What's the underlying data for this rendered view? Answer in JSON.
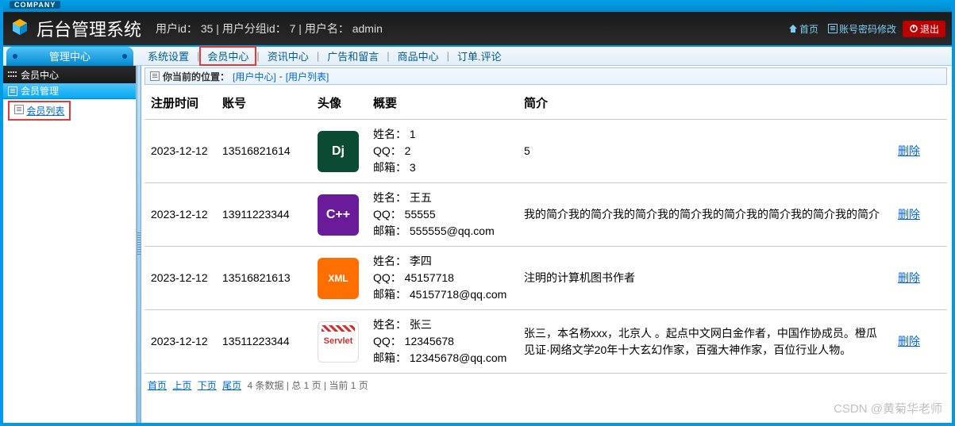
{
  "topbar": {
    "company": "COMPANY"
  },
  "header": {
    "title": "后台管理系统",
    "user_id_label": "用户id：",
    "user_id": "35",
    "group_id_label": "用户分组id：",
    "group_id": "7",
    "username_label": "用户名：",
    "username": "admin",
    "home": "首页",
    "pwd": "账号密码修改",
    "exit": "退出"
  },
  "menu": {
    "admin_tab": "管理中心",
    "items": [
      "系统设置",
      "会员中心",
      "资讯中心",
      "广告和留言",
      "商品中心",
      "订单.评论"
    ]
  },
  "sidebar": {
    "header": "会员中心",
    "section": "会员管理",
    "item": "会员列表"
  },
  "crumb": {
    "prefix": "你当前的位置：",
    "p1": "[用户中心]",
    "sep": "-",
    "p2": "[用户列表]"
  },
  "table": {
    "cols": [
      "注册时间",
      "账号",
      "头像",
      "概要",
      "简介",
      ""
    ],
    "labels": {
      "name": "姓名：",
      "qq": "QQ：",
      "email": "邮箱：",
      "del": "删除"
    },
    "rows": [
      {
        "time": "2023-12-12",
        "acct": "13516821614",
        "avatar": "Dj",
        "avcls": "av-dj",
        "name": "1",
        "qq": "2",
        "email": "3",
        "intro": "5"
      },
      {
        "time": "2023-12-12",
        "acct": "13911223344",
        "avatar": "C++",
        "avcls": "av-cpp",
        "name": "王五",
        "qq": "55555",
        "email": "555555@qq.com",
        "intro": "我的简介我的简介我的简介我的简介我的简介我的简介我的简介我的简介"
      },
      {
        "time": "2023-12-12",
        "acct": "13516821613",
        "avatar": "XML",
        "avcls": "av-xml",
        "name": "李四",
        "qq": "45157718",
        "email": "45157718@qq.com",
        "intro": "注明的计算机图书作者"
      },
      {
        "time": "2023-12-12",
        "acct": "13511223344",
        "avatar": "Servlet",
        "avcls": "av-srv",
        "name": "张三",
        "qq": "12345678",
        "email": "12345678@qq.com",
        "intro": "张三，本名杨xxx，北京人 。起点中文网白金作者，中国作协成员。橙瓜见证·网络文学20年十大玄幻作家，百强大神作家，百位行业人物。"
      }
    ]
  },
  "pager": {
    "first": "首页",
    "prev": "上页",
    "next": "下页",
    "last": "尾页",
    "info": "4 条数据 | 总 1 页 | 当前 1 页"
  },
  "watermark": "CSDN @黄菊华老师"
}
